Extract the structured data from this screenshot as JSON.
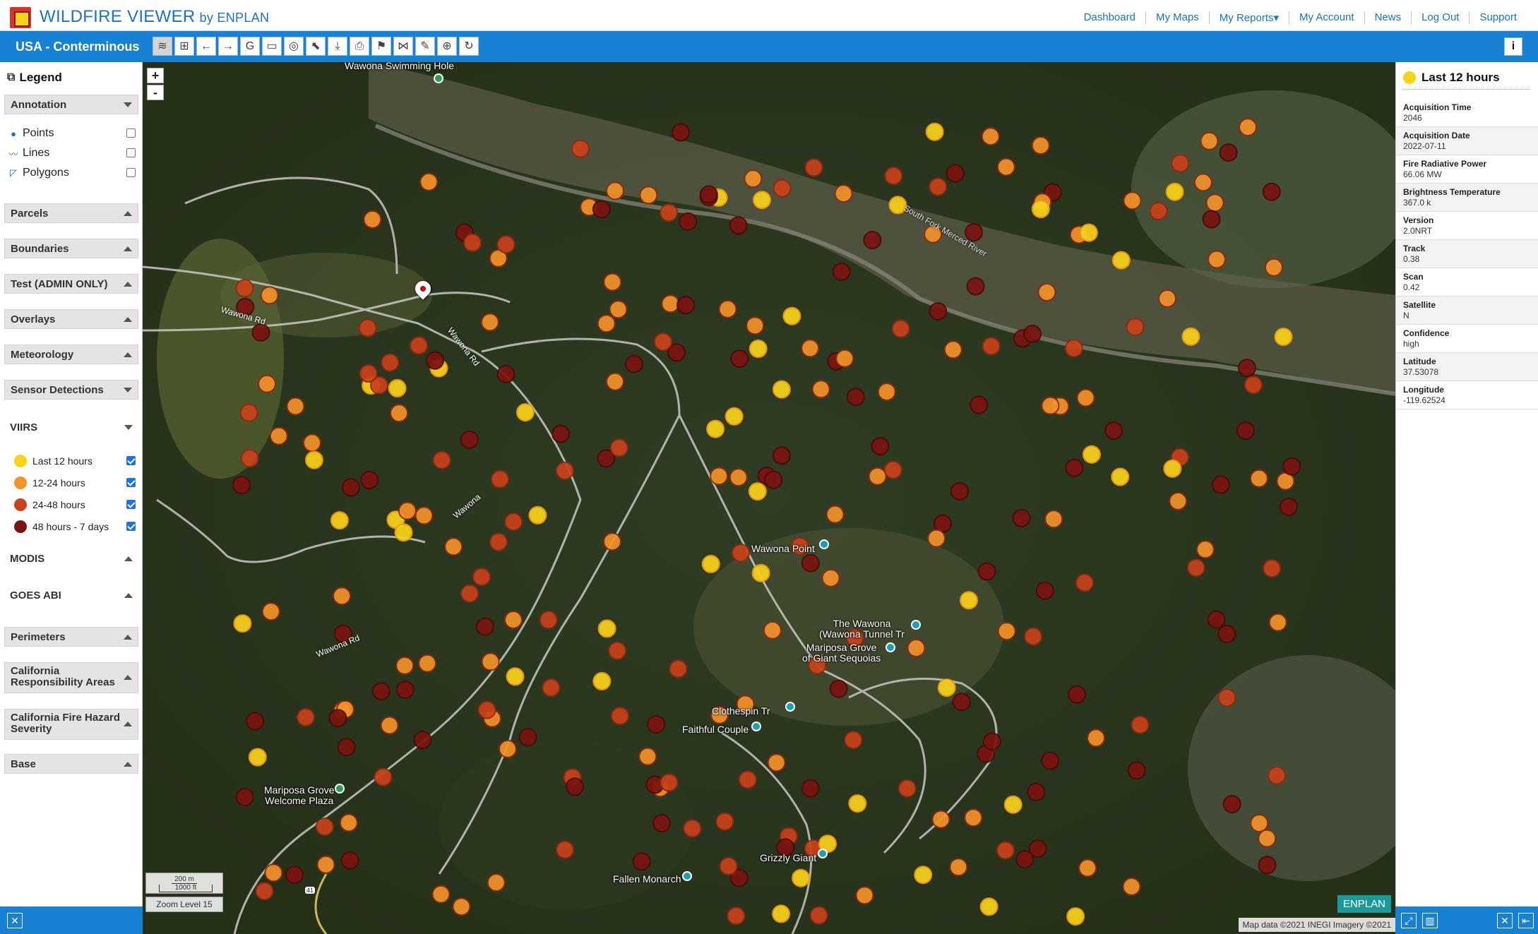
{
  "header": {
    "brand": "WILDFIRE VIEWER",
    "brand_by": "by ENPLAN",
    "nav": [
      "Dashboard",
      "My Maps",
      "My Reports▾",
      "My Account",
      "News",
      "Log Out",
      "Support"
    ]
  },
  "toolbar": {
    "region_title": "USA - Conterminous",
    "tools": [
      {
        "name": "layers-icon",
        "glyph": "≋"
      },
      {
        "name": "add-map-icon",
        "glyph": "⊞"
      },
      {
        "name": "back-arrow-icon",
        "glyph": "←"
      },
      {
        "name": "forward-arrow-icon",
        "glyph": "→"
      },
      {
        "name": "google-icon",
        "glyph": "G"
      },
      {
        "name": "ruler-icon",
        "glyph": "▭"
      },
      {
        "name": "overlap-circles-icon",
        "glyph": "◎"
      },
      {
        "name": "select-pointer-icon",
        "glyph": "⬉"
      },
      {
        "name": "download-icon",
        "glyph": "⤓"
      },
      {
        "name": "print-icon",
        "glyph": "⎙"
      },
      {
        "name": "bookmark-icon",
        "glyph": "⚑"
      },
      {
        "name": "share-icon",
        "glyph": "⋈"
      },
      {
        "name": "edit-icon",
        "glyph": "✎"
      },
      {
        "name": "crosshair-icon",
        "glyph": "⊕"
      },
      {
        "name": "refresh-icon",
        "glyph": "↻"
      }
    ],
    "info_label": "i"
  },
  "legend": {
    "title": "Legend",
    "annotation": {
      "label": "Annotation",
      "items": [
        {
          "label": "Points",
          "icon": "map-pin-icon",
          "checked": false
        },
        {
          "label": "Lines",
          "icon": "polyline-icon",
          "checked": false
        },
        {
          "label": "Polygons",
          "icon": "polygon-icon",
          "checked": false
        }
      ]
    },
    "sections_a": [
      "Parcels",
      "Boundaries",
      "Test (ADMIN ONLY)",
      "Overlays",
      "Meteorology",
      "Sensor Detections"
    ],
    "viirs": {
      "label": "VIIRS",
      "items": [
        {
          "label": "Last 12 hours",
          "color": "#f7d31a",
          "checked": true
        },
        {
          "label": "12-24 hours",
          "color": "#f2922a",
          "checked": true
        },
        {
          "label": "24-48 hours",
          "color": "#c8421a",
          "checked": true
        },
        {
          "label": "48 hours - 7 days",
          "color": "#7a1410",
          "checked": true
        }
      ]
    },
    "modis": "MODIS",
    "goes": "GOES ABI",
    "sections_b": [
      "Perimeters",
      "California Responsibility Areas",
      "California Fire Hazard Severity",
      "Base"
    ]
  },
  "map": {
    "zoom_in": "+",
    "zoom_out": "-",
    "scale_m": "200 m",
    "scale_ft": "1000 ft",
    "zoom_level": "Zoom Level  15",
    "badge": "ENPLAN",
    "credit": "Map data ©2021 INEGI Imagery ©2021",
    "places": [
      "Wawona Swimming Hole",
      "Wawona Point",
      "The Wawona\n(Wawona Tunnel Tr",
      "Mariposa Grove\nof Giant Sequoias",
      "Clothespin Tr",
      "Faithful Couple",
      "Mariposa Grove\nWelcome Plaza",
      "Grizzly Giant",
      "Fallen Monarch"
    ],
    "roads": [
      "Wawona Rd",
      "Wawona Rd",
      "Wawona",
      "Wawona Rd",
      "South Fork Merced River",
      "41"
    ]
  },
  "details": {
    "title": "Last 12 hours",
    "rows": [
      {
        "label": "Acquisition Time",
        "value": "2046"
      },
      {
        "label": "Acquisition Date",
        "value": "2022-07-11"
      },
      {
        "label": "Fire Radiative Power",
        "value": "66.06 MW"
      },
      {
        "label": "Brightness Temperature",
        "value": "367.0 k"
      },
      {
        "label": "Version",
        "value": "2.0NRT"
      },
      {
        "label": "Track",
        "value": "0.38"
      },
      {
        "label": "Scan",
        "value": "0.42"
      },
      {
        "label": "Satellite",
        "value": "N"
      },
      {
        "label": "Confidence",
        "value": "high"
      },
      {
        "label": "Latitude",
        "value": "37.53078"
      },
      {
        "label": "Longitude",
        "value": "-119.62524"
      }
    ]
  },
  "footer": {
    "close": "✕",
    "expand": "⤢",
    "chart": "▥",
    "close_right": "✕",
    "collapse": "⇤"
  }
}
